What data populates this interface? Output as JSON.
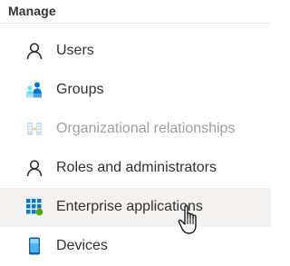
{
  "section": {
    "title": "Manage"
  },
  "items": [
    {
      "label": "Users",
      "icon": "user-icon",
      "state": "normal"
    },
    {
      "label": "Groups",
      "icon": "groups-icon",
      "state": "normal"
    },
    {
      "label": "Organizational relationships",
      "icon": "org-relationships-icon",
      "state": "disabled"
    },
    {
      "label": "Roles and administrators",
      "icon": "user-icon",
      "state": "normal"
    },
    {
      "label": "Enterprise applications",
      "icon": "enterprise-apps-icon",
      "state": "hover"
    },
    {
      "label": "Devices",
      "icon": "device-icon",
      "state": "normal"
    }
  ],
  "colors": {
    "text": "#323130",
    "disabled_text": "#a19f9d",
    "hover_bg": "#f3f2f1",
    "accent_blue": "#0078d4",
    "accent_green": "#57a300",
    "icon_light_blue": "#50e6ff"
  },
  "cursor": {
    "icon": "hand-pointer-cursor-icon"
  }
}
